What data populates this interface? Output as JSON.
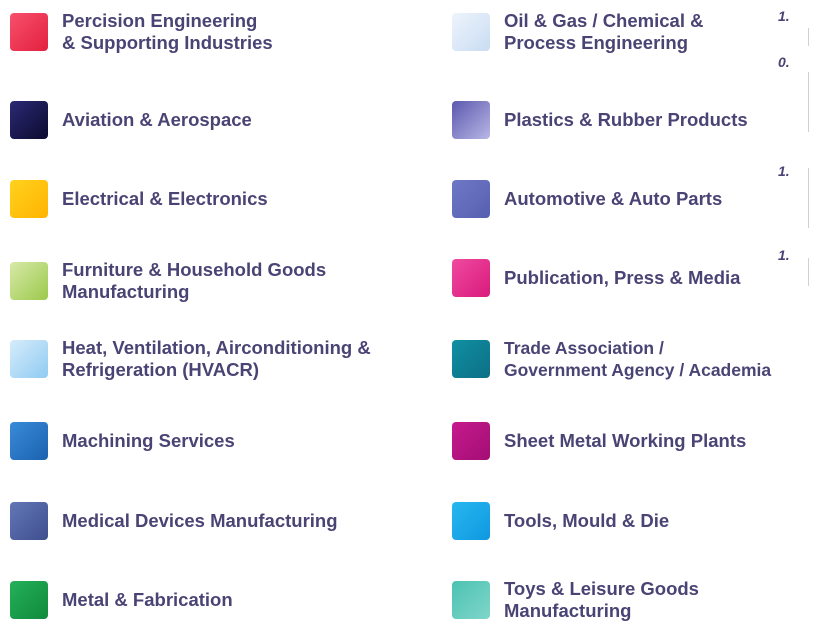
{
  "industries": [
    {
      "label": "Percision Engineering\n& Supporting Industries",
      "color_from": "#f7506c",
      "color_to": "#e3203e"
    },
    {
      "label": "Oil & Gas / Chemical &\nProcess Engineering",
      "color_from": "#eef4fc",
      "color_to": "#c9dcf3"
    },
    {
      "label": "Aviation & Aerospace",
      "color_from": "#2b2a75",
      "color_to": "#0c0a2e"
    },
    {
      "label": "Plastics & Rubber Products",
      "color_from": "#5b59ad",
      "color_to": "#b9b6e6"
    },
    {
      "label": "Electrical & Electronics",
      "color_from": "#ffd21e",
      "color_to": "#ffb300"
    },
    {
      "label": "Automotive & Auto Parts",
      "color_from": "#6f78c6",
      "color_to": "#5660b0"
    },
    {
      "label": "Furniture & Household Goods\nManufacturing",
      "color_from": "#d7e9a8",
      "color_to": "#9cc94c"
    },
    {
      "label": "Publication, Press & Media",
      "color_from": "#f04aa0",
      "color_to": "#d91a7c"
    },
    {
      "label": "Heat, Ventilation, Airconditioning &\nRefrigeration (HVACR)",
      "color_from": "#d6ecfb",
      "color_to": "#8fcbf2"
    },
    {
      "label": "Trade Association /\nGovernment Agency / Academia",
      "color_from": "#0f8fa3",
      "color_to": "#0e6f85"
    },
    {
      "label": "Machining Services",
      "color_from": "#3a8bd8",
      "color_to": "#1b62b0"
    },
    {
      "label": "Sheet Metal Working Plants",
      "color_from": "#c61a8e",
      "color_to": "#a30e73"
    },
    {
      "label": "Medical Devices Manufacturing",
      "color_from": "#6276b6",
      "color_to": "#3f4f8f"
    },
    {
      "label": "Tools, Mould & Die",
      "color_from": "#28b7f0",
      "color_to": "#0f98e0"
    },
    {
      "label": "Metal & Fabrication",
      "color_from": "#25b05a",
      "color_to": "#0f8a3c"
    },
    {
      "label": "Toys & Leisure Goods\nManufacturing",
      "color_from": "#4cc2b2",
      "color_to": "#7fd6c9"
    }
  ],
  "edge_labels": [
    "1.",
    "0.",
    "1.",
    "1."
  ]
}
